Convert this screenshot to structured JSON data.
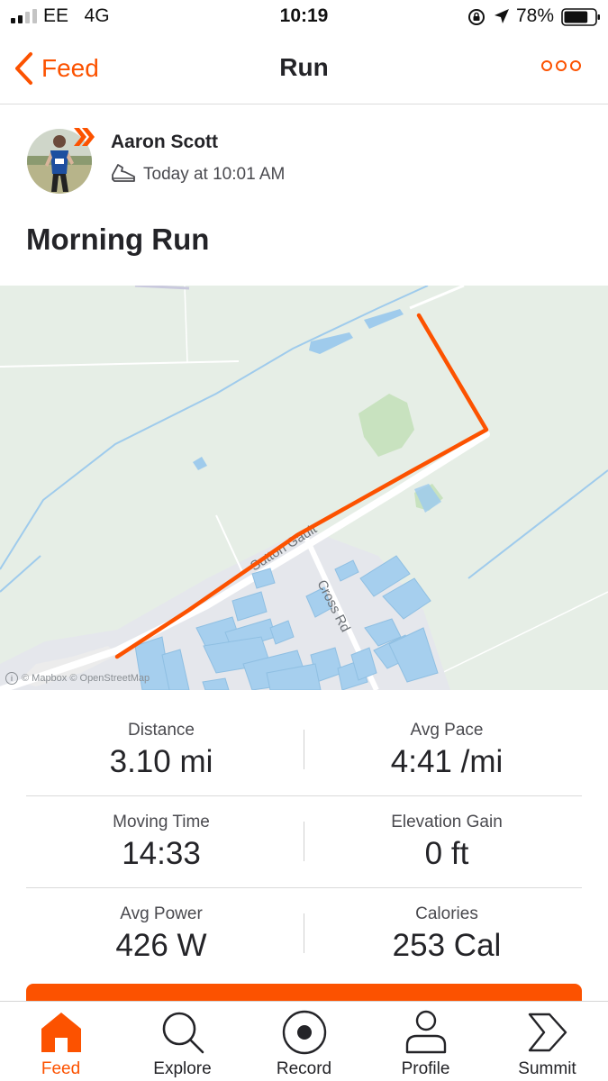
{
  "status_bar": {
    "carrier": "EE",
    "network": "4G",
    "time": "10:19",
    "battery_percent": "78%",
    "battery_level": 0.78
  },
  "nav": {
    "back_label": "Feed",
    "title": "Run",
    "more_icon": "more-icon"
  },
  "activity": {
    "athlete_name": "Aaron Scott",
    "timestamp": "Today at 10:01 AM",
    "sport_icon": "shoe-icon",
    "title": "Morning Run"
  },
  "map": {
    "road_labels": [
      "Sutton Gault",
      "Cross Rd"
    ],
    "attribution": "© Mapbox © OpenStreetMap"
  },
  "stats": [
    {
      "label": "Distance",
      "value": "3.10 mi"
    },
    {
      "label": "Avg Pace",
      "value": "4:41 /mi"
    },
    {
      "label": "Moving Time",
      "value": "14:33"
    },
    {
      "label": "Elevation Gain",
      "value": "0 ft"
    },
    {
      "label": "Avg Power",
      "value": "426 W"
    },
    {
      "label": "Calories",
      "value": "253 Cal"
    }
  ],
  "tabs": [
    {
      "label": "Feed",
      "icon": "home-icon",
      "active": true
    },
    {
      "label": "Explore",
      "icon": "search-icon",
      "active": false
    },
    {
      "label": "Record",
      "icon": "record-icon",
      "active": false
    },
    {
      "label": "Profile",
      "icon": "profile-icon",
      "active": false
    },
    {
      "label": "Summit",
      "icon": "summit-icon",
      "active": false
    }
  ],
  "colors": {
    "accent": "#fc5200",
    "text": "#242428",
    "map_land": "#e6eee6",
    "map_water": "#9fcbec",
    "route": "#fc5200"
  }
}
